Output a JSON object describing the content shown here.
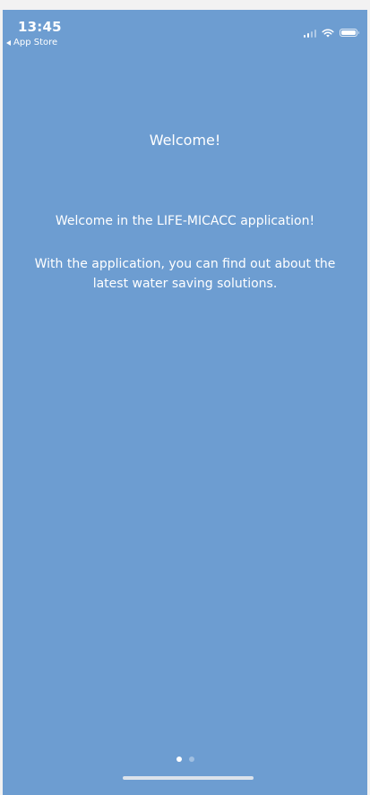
{
  "status_bar": {
    "time": "13:45",
    "back_app_label": "App Store",
    "signal_icon": "cellular-signal-icon",
    "wifi_icon": "wifi-icon",
    "battery_icon": "battery-icon"
  },
  "onboarding": {
    "title": "Welcome!",
    "paragraph_1": "Welcome in the LIFE-MICACC application!",
    "paragraph_2": "With the application, you can find out about the latest water saving solutions."
  },
  "pager": {
    "page_count": 2,
    "current_page": 1
  },
  "colors": {
    "background": "#6d9dd1",
    "text": "#ffffff"
  }
}
